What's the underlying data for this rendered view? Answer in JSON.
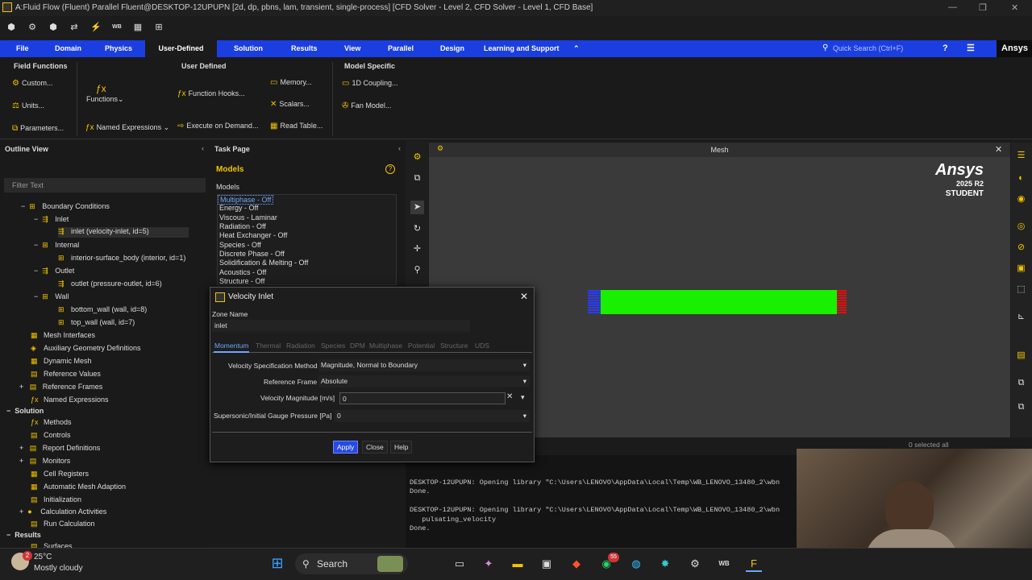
{
  "titlebar": {
    "title": "A:Fluid Flow (Fluent) Parallel Fluent@DESKTOP-12UPUPN  [2d, dp, pbns, lam, transient, single-process] [CFD Solver - Level 2, CFD Solver - Level 1, CFD Base]"
  },
  "menubar": {
    "items": [
      "File",
      "Domain",
      "Physics",
      "User-Defined",
      "Solution",
      "Results",
      "View",
      "Parallel",
      "Design",
      "Learning and Support"
    ],
    "search_placeholder": "Quick Search (Ctrl+F)",
    "brand": "Ansys"
  },
  "ribbon": {
    "field_functions": {
      "title": "Field Functions",
      "custom": "Custom...",
      "units": "Units...",
      "parameters": "Parameters..."
    },
    "user_defined": {
      "title": "User Defined",
      "functions": "Functions",
      "function_hooks": "Function Hooks...",
      "named_expressions": "Named Expressions",
      "execute_on_demand": "Execute on Demand...",
      "memory": "Memory...",
      "scalars": "Scalars...",
      "read_table": "Read Table..."
    },
    "model_specific": {
      "title": "Model Specific",
      "coupling": "1D Coupling...",
      "fan_model": "Fan Model..."
    }
  },
  "outline": {
    "title": "Outline View",
    "filter_placeholder": "Filter Text",
    "items": [
      "Boundary Conditions",
      "Inlet",
      "inlet (velocity-inlet, id=5)",
      "Internal",
      "interior-surface_body (interior, id=1)",
      "Outlet",
      "outlet (pressure-outlet, id=6)",
      "Wall",
      "bottom_wall (wall, id=8)",
      "top_wall (wall, id=7)",
      "Mesh Interfaces",
      "Auxiliary Geometry Definitions",
      "Dynamic Mesh",
      "Reference Values",
      "Reference Frames",
      "Named Expressions",
      "Solution",
      "Methods",
      "Controls",
      "Report Definitions",
      "Monitors",
      "Cell Registers",
      "Automatic Mesh Adaption",
      "Initialization",
      "Calculation Activities",
      "Run Calculation",
      "Results",
      "Surfaces"
    ]
  },
  "taskpage": {
    "title": "Task Page",
    "section": "Models",
    "list_label": "Models",
    "models": [
      "Multiphase - Off",
      "Energy - Off",
      "Viscous - Laminar",
      "Radiation - Off",
      "Heat Exchanger - Off",
      "Species - Off",
      "Discrete Phase - Off",
      "Solidification & Melting - Off",
      "Acoustics - Off",
      "Structure - Off"
    ]
  },
  "graphics": {
    "title": "Mesh",
    "logo_brand": "Ansys",
    "logo_version": "2025 R2",
    "logo_edition": "STUDENT",
    "selected_info": "0 selected all",
    "geometry_color": "#18f000"
  },
  "console": {
    "lines": [
      "Done.",
      "DESKTOP-12UPUPN: Opening library \"C:\\Users\\LENOVO\\AppData\\Local\\Temp\\WB_LENOVO_13480_2\\wbn",
      "Done.",
      "DESKTOP-12UPUPN: Opening library \"C:\\Users\\LENOVO\\AppData\\Local\\Temp\\WB_LENOVO_13480_2\\wbn",
      "   pulsating_velocity",
      "Done."
    ]
  },
  "dialog": {
    "title": "Velocity Inlet",
    "zone_name_label": "Zone Name",
    "zone_name_value": "inlet",
    "tabs": [
      "Momentum",
      "Thermal",
      "Radiation",
      "Species",
      "DPM",
      "Multiphase",
      "Potential",
      "Structure",
      "UDS"
    ],
    "velocity_spec_label": "Velocity Specification Method",
    "velocity_spec_value": "Magnitude, Normal to Boundary",
    "ref_frame_label": "Reference Frame",
    "ref_frame_value": "Absolute",
    "velocity_mag_label": "Velocity Magnitude [m/s]",
    "velocity_mag_value": "0",
    "pressure_label": "Supersonic/Initial Gauge Pressure [Pa]",
    "pressure_value": "0",
    "apply": "Apply",
    "close": "Close",
    "help": "Help"
  },
  "taskbar": {
    "weather_temp": "25°C",
    "weather_desc": "Mostly cloudy",
    "weather_badge": "2",
    "search": "Search",
    "whatsapp_badge": "55"
  }
}
